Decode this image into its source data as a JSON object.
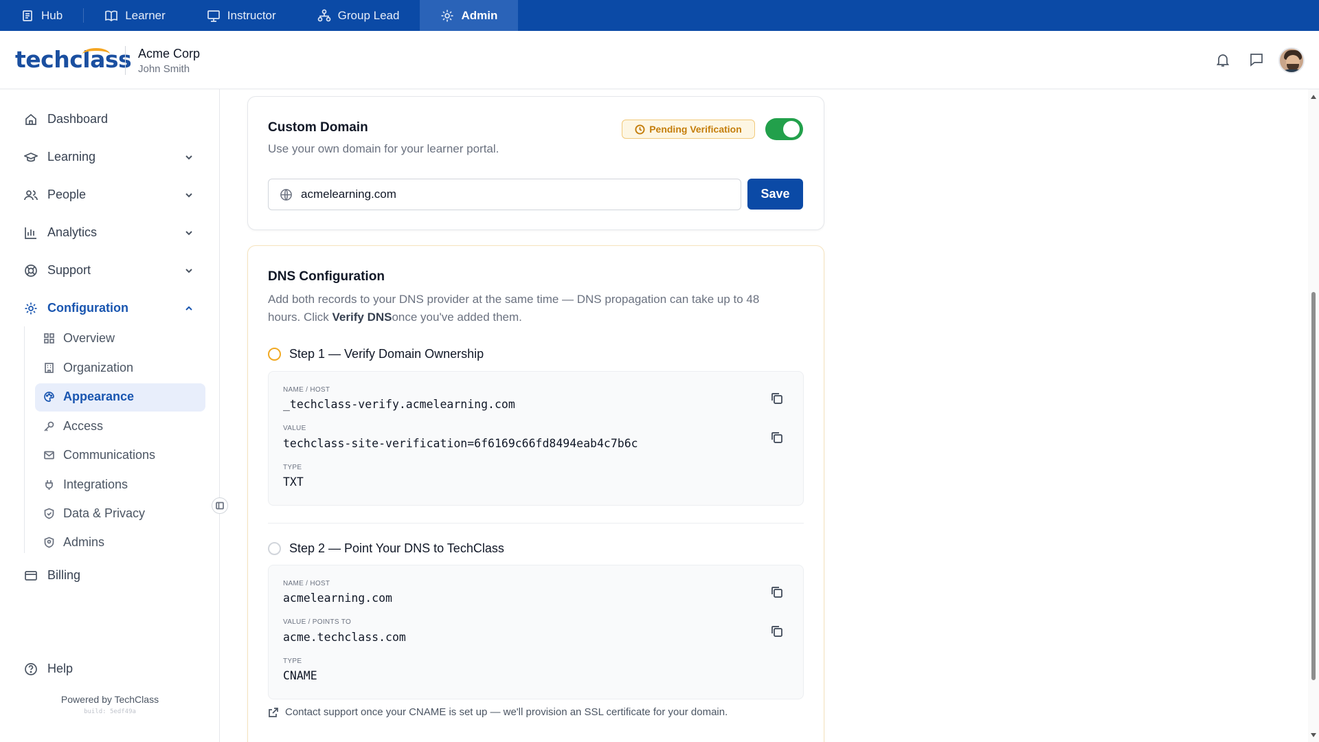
{
  "topnav": {
    "items": [
      {
        "label": "Hub",
        "icon": "hub-icon"
      },
      {
        "label": "Learner",
        "icon": "book-icon"
      },
      {
        "label": "Instructor",
        "icon": "presentation-icon"
      },
      {
        "label": "Group Lead",
        "icon": "org-chart-icon"
      },
      {
        "label": "Admin",
        "icon": "gear-icon",
        "active": true
      }
    ]
  },
  "header": {
    "logo_text": "techclass",
    "org_name": "Acme Corp",
    "user_name": "John Smith"
  },
  "sidebar": {
    "items": [
      {
        "label": "Dashboard"
      },
      {
        "label": "Learning"
      },
      {
        "label": "People"
      },
      {
        "label": "Analytics"
      },
      {
        "label": "Support"
      },
      {
        "label": "Configuration"
      }
    ],
    "sub_items": [
      {
        "label": "Overview"
      },
      {
        "label": "Organization"
      },
      {
        "label": "Appearance",
        "active": true
      },
      {
        "label": "Access"
      },
      {
        "label": "Communications"
      },
      {
        "label": "Integrations"
      },
      {
        "label": "Data & Privacy"
      },
      {
        "label": "Admins"
      }
    ],
    "billing": "Billing",
    "help": "Help",
    "powered_by": "Powered by TechClass",
    "build": "build: 5edf49a"
  },
  "custom_domain": {
    "title": "Custom Domain",
    "subtitle": "Use your own domain for your learner portal.",
    "status_badge": "Pending Verification",
    "enabled": true,
    "domain_value": "acmelearning.com",
    "save_label": "Save"
  },
  "dns": {
    "title": "DNS Configuration",
    "desc_part1": "Add both records to your DNS provider at the same time — DNS propagation can take up to 48",
    "desc_part2": "hours. Click ",
    "desc_bold": "Verify DNS",
    "desc_part3": "once you've added them.",
    "step1": {
      "title": "Step 1 — Verify Domain Ownership",
      "name_label": "NAME / HOST",
      "name_value": "_techclass-verify.acmelearning.com",
      "value_label": "VALUE",
      "value_value": "techclass-site-verification=6f6169c66fd8494eab4c7b6c",
      "type_label": "TYPE",
      "type_value": "TXT"
    },
    "step2": {
      "title": "Step 2 — Point Your DNS to TechClass",
      "name_label": "NAME / HOST",
      "name_value": "acmelearning.com",
      "value_label": "VALUE / POINTS TO",
      "value_value": "acme.techclass.com",
      "type_label": "TYPE",
      "type_value": "CNAME"
    },
    "footnote": "Contact support once your CNAME is set up — we'll provision an SSL certificate for your domain."
  },
  "colors": {
    "brand": "#0b4aa6",
    "accent_active": "#1a56b0",
    "pending": "#c47d0a",
    "toggle_on": "#22a04b"
  }
}
